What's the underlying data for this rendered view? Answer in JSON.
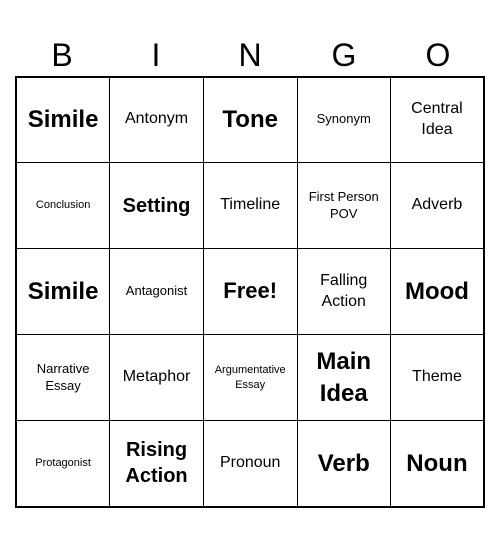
{
  "header": {
    "letters": [
      "B",
      "I",
      "N",
      "G",
      "O"
    ]
  },
  "grid": [
    [
      {
        "text": "Simile",
        "size": "xl"
      },
      {
        "text": "Antonym",
        "size": "md"
      },
      {
        "text": "Tone",
        "size": "xl"
      },
      {
        "text": "Synonym",
        "size": "sm"
      },
      {
        "text": "Central Idea",
        "size": "md"
      }
    ],
    [
      {
        "text": "Conclusion",
        "size": "xs"
      },
      {
        "text": "Setting",
        "size": "lg"
      },
      {
        "text": "Timeline",
        "size": "md"
      },
      {
        "text": "First Person POV",
        "size": "sm"
      },
      {
        "text": "Adverb",
        "size": "md"
      }
    ],
    [
      {
        "text": "Simile",
        "size": "xl"
      },
      {
        "text": "Antagonist",
        "size": "sm"
      },
      {
        "text": "Free!",
        "size": "free"
      },
      {
        "text": "Falling Action",
        "size": "md"
      },
      {
        "text": "Mood",
        "size": "xl"
      }
    ],
    [
      {
        "text": "Narrative Essay",
        "size": "sm"
      },
      {
        "text": "Metaphor",
        "size": "md"
      },
      {
        "text": "Argumentative Essay",
        "size": "xs"
      },
      {
        "text": "Main Idea",
        "size": "xl"
      },
      {
        "text": "Theme",
        "size": "md"
      }
    ],
    [
      {
        "text": "Protagonist",
        "size": "xs"
      },
      {
        "text": "Rising Action",
        "size": "lg"
      },
      {
        "text": "Pronoun",
        "size": "md"
      },
      {
        "text": "Verb",
        "size": "xl"
      },
      {
        "text": "Noun",
        "size": "xl"
      }
    ]
  ]
}
